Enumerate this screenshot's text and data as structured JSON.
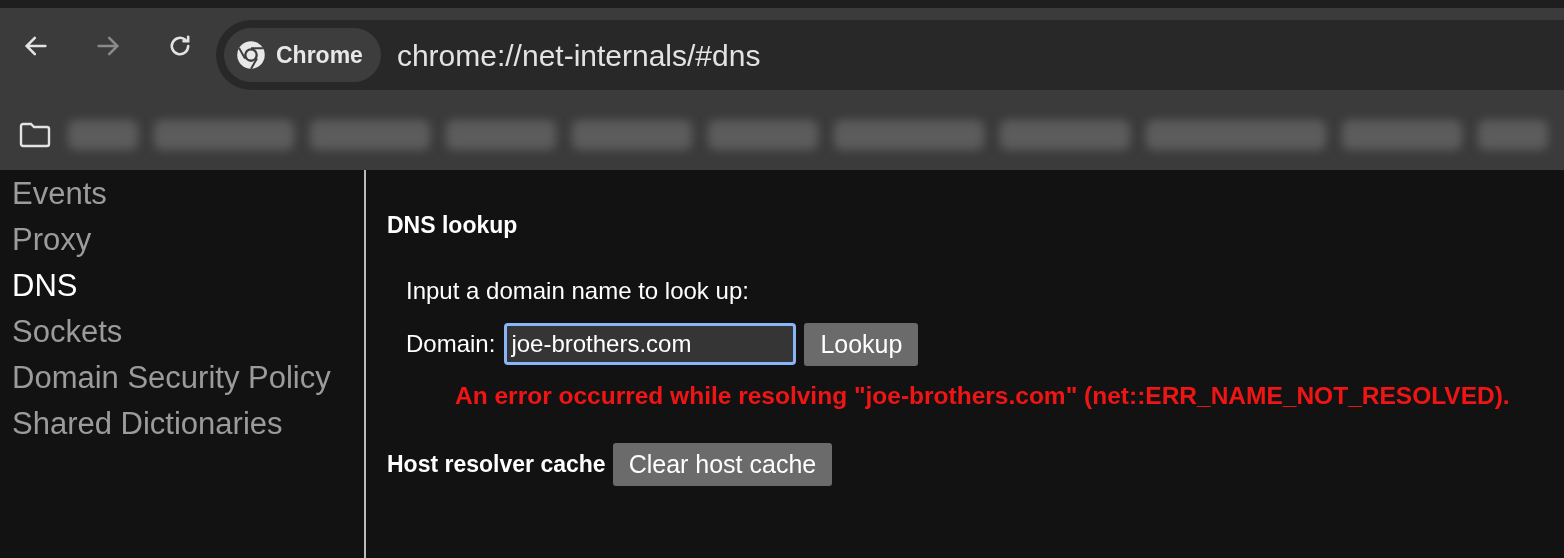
{
  "toolbar": {
    "back": {
      "disabled": false
    },
    "forward": {
      "disabled": true
    },
    "site_chip": "Chrome",
    "url": "chrome://net-internals/#dns"
  },
  "bookmarks_bar": {
    "items": [
      {
        "kind": "blurred"
      },
      {
        "kind": "blurred"
      },
      {
        "kind": "blurred"
      },
      {
        "kind": "blurred"
      },
      {
        "kind": "blurred"
      },
      {
        "kind": "blurred"
      },
      {
        "kind": "blurred"
      },
      {
        "kind": "blurred"
      },
      {
        "kind": "blurred"
      },
      {
        "kind": "blurred"
      },
      {
        "kind": "blurred"
      }
    ]
  },
  "sidebar": {
    "items": [
      {
        "label": "Events",
        "selected": false
      },
      {
        "label": "Proxy",
        "selected": false
      },
      {
        "label": "DNS",
        "selected": true
      },
      {
        "label": "Sockets",
        "selected": false
      },
      {
        "label": "Domain Security Policy",
        "selected": false
      },
      {
        "label": "Shared Dictionaries",
        "selected": false
      }
    ]
  },
  "dns_lookup": {
    "heading": "DNS lookup",
    "prompt": "Input a domain name to look up:",
    "domain_label": "Domain:",
    "domain_value": "joe-brothers.com",
    "lookup_button": "Lookup",
    "error": "An error occurred while resolving \"joe-brothers.com\" (net::ERR_NAME_NOT_RESOLVED)."
  },
  "host_cache": {
    "heading": "Host resolver cache",
    "clear_button": "Clear host cache"
  }
}
